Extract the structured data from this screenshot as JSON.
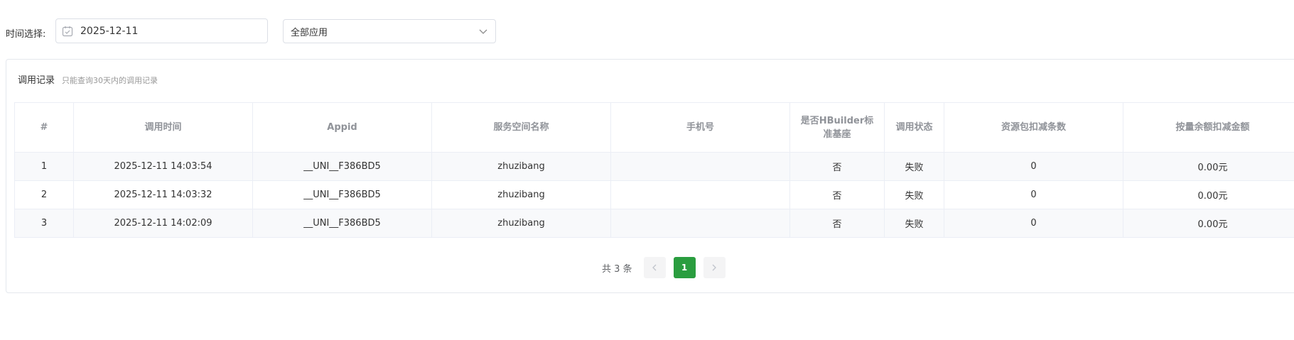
{
  "filters": {
    "time_label": "时间选择:",
    "date_value": "2025-12-11",
    "app_select_value": "全部应用"
  },
  "card": {
    "title": "调用记录",
    "subtitle": "只能查询30天内的调用记录"
  },
  "table": {
    "columns": [
      "#",
      "调用时间",
      "Appid",
      "服务空间名称",
      "手机号",
      "是否HBuilder标准基座",
      "调用状态",
      "资源包扣减条数",
      "按量余额扣减金额"
    ],
    "rows": [
      [
        "1",
        "2025-12-11 14:03:54",
        "__UNI__F386BD5",
        "zhuzibang",
        "",
        "否",
        "失败",
        "0",
        "0.00元"
      ],
      [
        "2",
        "2025-12-11 14:03:32",
        "__UNI__F386BD5",
        "zhuzibang",
        "",
        "否",
        "失败",
        "0",
        "0.00元"
      ],
      [
        "3",
        "2025-12-11 14:02:09",
        "__UNI__F386BD5",
        "zhuzibang",
        "",
        "否",
        "失败",
        "0",
        "0.00元"
      ]
    ]
  },
  "pagination": {
    "total_text": "共 3 条",
    "current_page": "1"
  },
  "colors": {
    "accent": "#2a9d3f",
    "border": "#ebeef5",
    "header_text": "#909399"
  }
}
